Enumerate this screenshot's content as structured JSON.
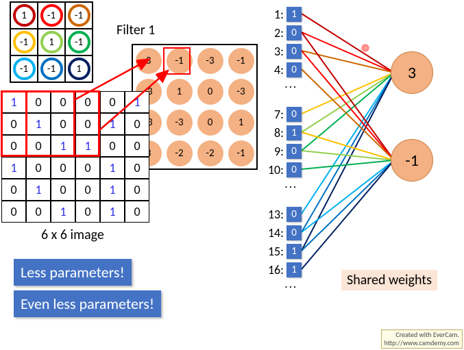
{
  "filter": {
    "label": "Filter 1",
    "colors": [
      "#bf0000",
      "#ff0000",
      "#cc6600",
      "#ffc000",
      "#92d050",
      "#00b050",
      "#00b0f0",
      "#0070c0",
      "#002060"
    ],
    "values": [
      1,
      -1,
      -1,
      -1,
      1,
      -1,
      -1,
      -1,
      1
    ]
  },
  "feature_map": {
    "rows": [
      [
        3,
        -1,
        -3,
        -1
      ],
      [
        -3,
        1,
        0,
        -3
      ],
      [
        -3,
        -3,
        0,
        1
      ],
      [
        3,
        -2,
        -2,
        -1
      ]
    ],
    "highlight_index": [
      0,
      1
    ]
  },
  "image": {
    "caption": "6 x 6 image",
    "rows": [
      [
        1,
        0,
        0,
        0,
        0,
        1
      ],
      [
        0,
        1,
        0,
        0,
        1,
        0
      ],
      [
        0,
        0,
        1,
        1,
        0,
        0
      ],
      [
        1,
        0,
        0,
        0,
        1,
        0
      ],
      [
        0,
        1,
        0,
        0,
        1,
        0
      ],
      [
        0,
        0,
        1,
        0,
        1,
        0
      ]
    ],
    "highlight_first": {
      "r": 0,
      "c": 0
    },
    "highlight_second": {
      "r": 0,
      "c": 1
    }
  },
  "blueboxes": {
    "less": "Less parameters!",
    "evenless": "Even less parameters!"
  },
  "shared_label": "Shared weights",
  "inputs": {
    "group1": [
      {
        "idx": "1:",
        "val": "1"
      },
      {
        "idx": "2:",
        "val": "0"
      },
      {
        "idx": "3:",
        "val": "0"
      },
      {
        "idx": "4:",
        "val": "0"
      }
    ],
    "group2": [
      {
        "idx": "7:",
        "val": "0"
      },
      {
        "idx": "8:",
        "val": "1"
      },
      {
        "idx": "9:",
        "val": "0"
      },
      {
        "idx": "10:",
        "val": "0"
      }
    ],
    "group3": [
      {
        "idx": "13:",
        "val": "0"
      },
      {
        "idx": "14:",
        "val": "0"
      },
      {
        "idx": "15:",
        "val": "1"
      },
      {
        "idx": "16:",
        "val": "1"
      }
    ]
  },
  "outputs": {
    "top": "3",
    "bottom": "-1"
  },
  "conn_colors": [
    "#bf0000",
    "#ff0000",
    "#cc6600",
    "#ffc000",
    "#92d050",
    "#00b050",
    "#00b0f0",
    "#0070c0",
    "#002060"
  ],
  "evercam": {
    "line1": "Created with EverCam.",
    "line2": "http://www.camdemy.com"
  }
}
